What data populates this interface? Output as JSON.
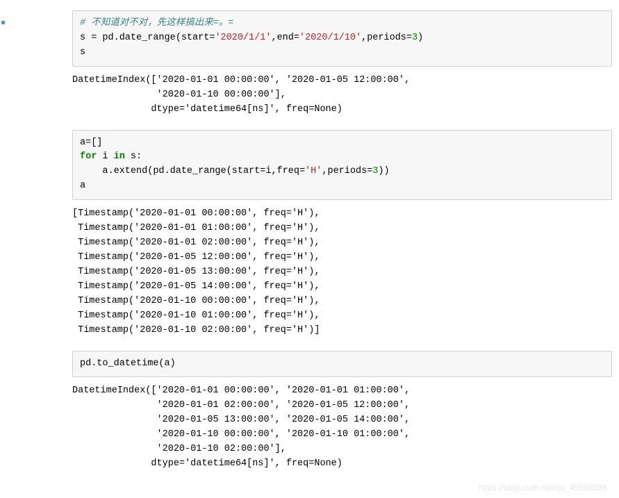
{
  "cell1": {
    "line1_comment": "# 不知道对不对，先这样搞出来=。=",
    "line2_a": "s = pd.date_range(start=",
    "line2_s1": "'2020/1/1'",
    "line2_b": ",end=",
    "line2_s2": "'2020/1/10'",
    "line2_c": ",periods=",
    "line2_num": "3",
    "line2_d": ")",
    "line3": "s"
  },
  "out1": "DatetimeIndex(['2020-01-01 00:00:00', '2020-01-05 12:00:00',\n               '2020-01-10 00:00:00'],\n              dtype='datetime64[ns]', freq=None)",
  "cell2": {
    "line1": "a=[]",
    "line2_for": "for",
    "line2_mid": " i ",
    "line2_in": "in",
    "line2_rest": " s:",
    "line3_a": "    a.extend(pd.date_range(start=i,freq=",
    "line3_s": "'H'",
    "line3_b": ",periods=",
    "line3_num": "3",
    "line3_c": "))",
    "line4": "a"
  },
  "out2": "[Timestamp('2020-01-01 00:00:00', freq='H'),\n Timestamp('2020-01-01 01:00:00', freq='H'),\n Timestamp('2020-01-01 02:00:00', freq='H'),\n Timestamp('2020-01-05 12:00:00', freq='H'),\n Timestamp('2020-01-05 13:00:00', freq='H'),\n Timestamp('2020-01-05 14:00:00', freq='H'),\n Timestamp('2020-01-10 00:00:00', freq='H'),\n Timestamp('2020-01-10 01:00:00', freq='H'),\n Timestamp('2020-01-10 02:00:00', freq='H')]",
  "cell3": {
    "line1": "pd.to_datetime(a)"
  },
  "out3": "DatetimeIndex(['2020-01-01 00:00:00', '2020-01-01 01:00:00',\n               '2020-01-01 02:00:00', '2020-01-05 12:00:00',\n               '2020-01-05 13:00:00', '2020-01-05 14:00:00',\n               '2020-01-10 00:00:00', '2020-01-10 01:00:00',\n               '2020-01-10 02:00:00'],\n              dtype='datetime64[ns]', freq=None)",
  "watermark": "https://blog.csdn.net/qq_45556599"
}
